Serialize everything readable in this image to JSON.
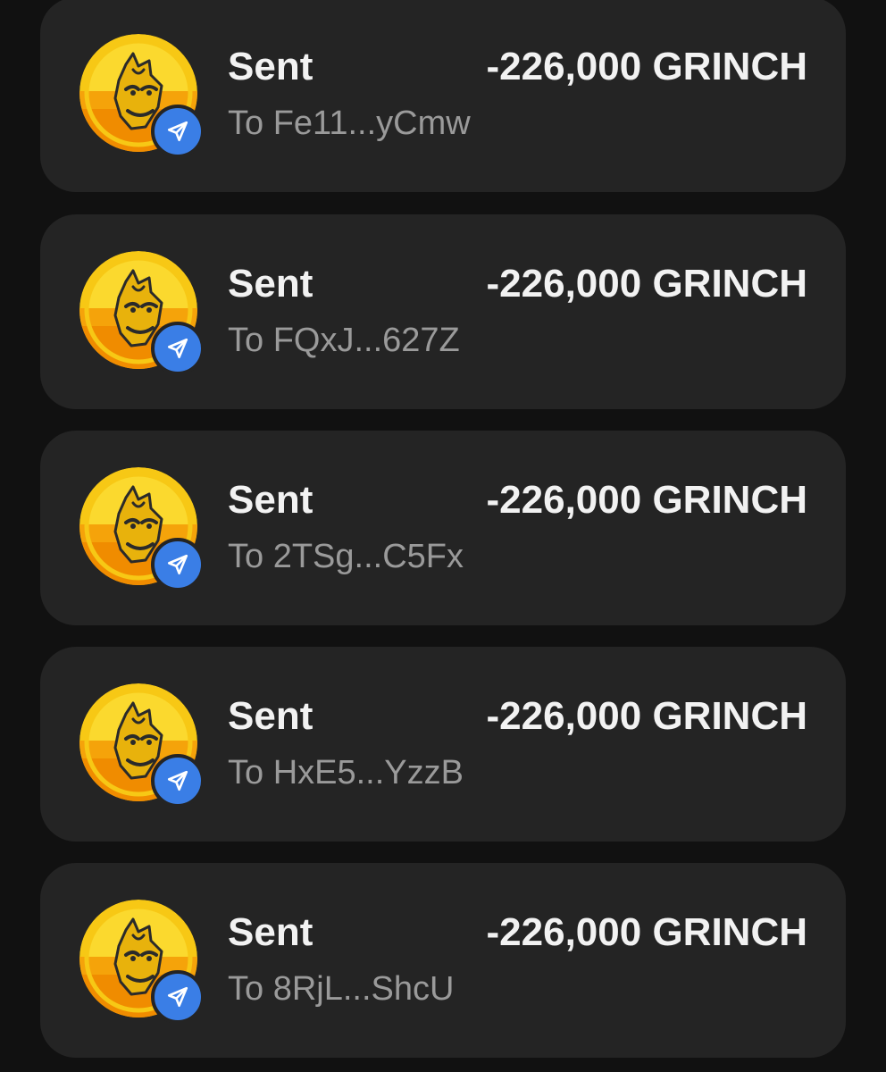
{
  "transactions": [
    {
      "type": "Sent",
      "amount": "-226,000 GRINCH",
      "recipient": "To Fe11...yCmw",
      "token_icon": "grinch-coin-icon",
      "badge_icon": "send-arrow-icon"
    },
    {
      "type": "Sent",
      "amount": "-226,000 GRINCH",
      "recipient": "To FQxJ...627Z",
      "token_icon": "grinch-coin-icon",
      "badge_icon": "send-arrow-icon"
    },
    {
      "type": "Sent",
      "amount": "-226,000 GRINCH",
      "recipient": "To 2TSg...C5Fx",
      "token_icon": "grinch-coin-icon",
      "badge_icon": "send-arrow-icon"
    },
    {
      "type": "Sent",
      "amount": "-226,000 GRINCH",
      "recipient": "To HxE5...YzzB",
      "token_icon": "grinch-coin-icon",
      "badge_icon": "send-arrow-icon"
    },
    {
      "type": "Sent",
      "amount": "-226,000 GRINCH",
      "recipient": "To 8RjL...ShcU",
      "token_icon": "grinch-coin-icon",
      "badge_icon": "send-arrow-icon"
    }
  ],
  "colors": {
    "background": "#111111",
    "card": "#242424",
    "primary_text": "#f2f2f2",
    "secondary_text": "#9a9a9a",
    "badge": "#3a7ee6",
    "coin_yellow": "#f7c815",
    "coin_orange": "#f08c00"
  }
}
